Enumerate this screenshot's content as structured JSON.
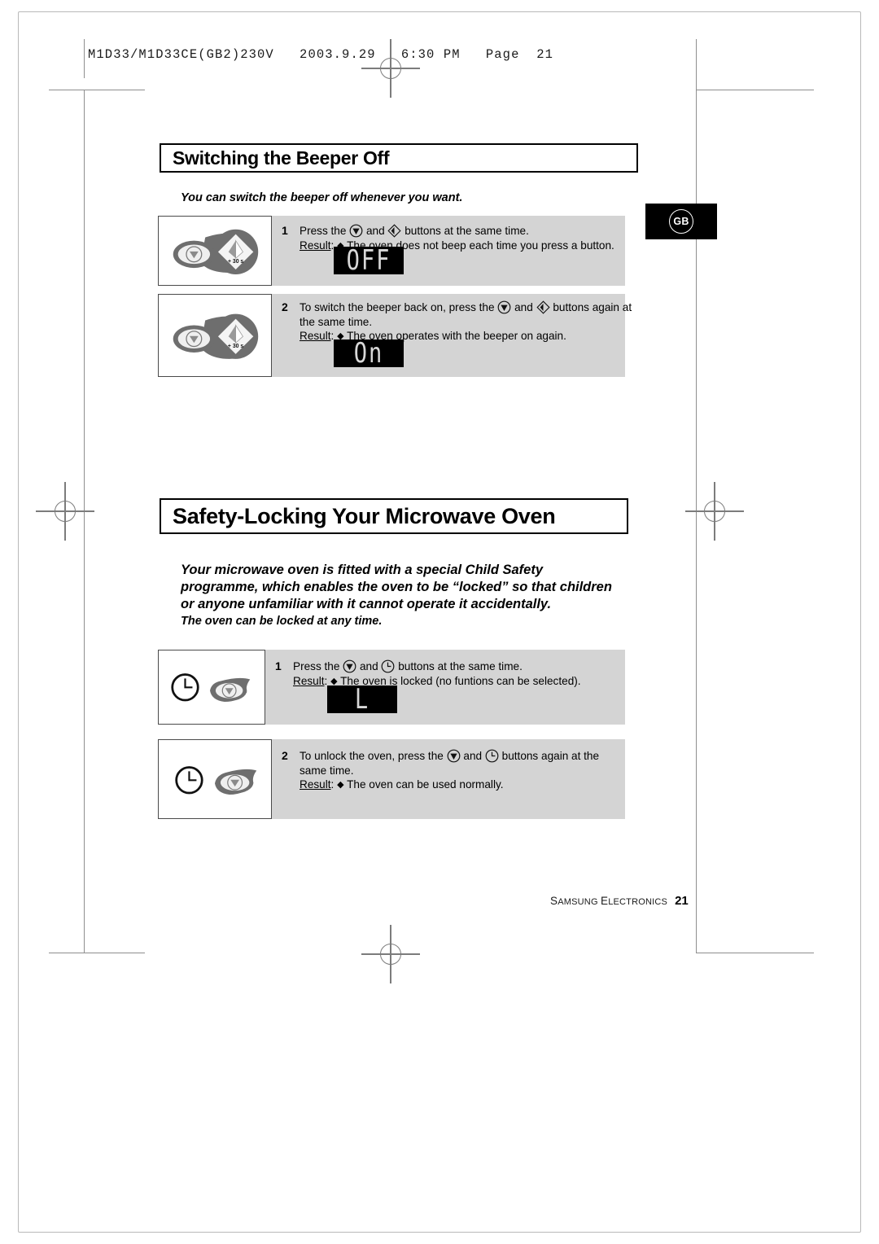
{
  "print_header": "M1D33/M1D33CE(GB2)230V   2003.9.29   6:30 PM   Page  21",
  "region_badge": {
    "code": "GB",
    "name": "gb-region-badge"
  },
  "sections": [
    {
      "id": "beeper",
      "title": "Switching the Beeper Off",
      "intro": "You can switch the beeper off whenever you want.",
      "steps": [
        {
          "number": "1",
          "text_before": "Press the",
          "icon_1": "stop-triangle-icon",
          "text_mid": "and",
          "icon_2": "start-diamond-icon",
          "text_after": "buttons at the same time.",
          "result_label": "Result",
          "result_text": "The oven does not beep each time you press a button.",
          "display": "OFF"
        },
        {
          "number": "2",
          "text_before": "To switch the beeper back on, press the",
          "icon_1": "stop-triangle-icon",
          "text_mid": "and",
          "icon_2": "start-diamond-icon",
          "text_after": "buttons again at the same time.",
          "result_label": "Result",
          "result_text": "The oven operates with the beeper on again.",
          "display": "On"
        }
      ]
    },
    {
      "id": "safety-lock",
      "title": "Safety-Locking Your Microwave Oven",
      "paragraph": "Your microwave oven is fitted with a special Child Safety programme, which enables the oven to be “locked” so that children or anyone unfamiliar with it cannot operate it accidentally.",
      "intro": "The oven can be locked at any time.",
      "steps": [
        {
          "number": "1",
          "text_before": "Press the",
          "icon_1": "stop-triangle-icon",
          "text_mid": "and",
          "icon_2": "clock-icon",
          "text_after": "buttons at the same time.",
          "result_label": "Result",
          "result_text": "The oven is locked (no funtions can be selected).",
          "display": "L"
        },
        {
          "number": "2",
          "text_before": "To unlock the oven, press the",
          "icon_1": "stop-triangle-icon",
          "text_mid": "and",
          "icon_2": "clock-icon",
          "text_after": "buttons again at the same time.",
          "result_label": "Result",
          "result_text": "The oven can be used normally.",
          "display": null
        }
      ]
    }
  ],
  "illustrations": {
    "plus30_label": "+ 30 s"
  },
  "footer": {
    "brand_s": "S",
    "brand_amsung": "AMSUNG",
    "brand_e": "E",
    "brand_lectronics": "LECTRONICS",
    "page_number": "21"
  },
  "colors": {
    "panel_gray": "#d4d4d4",
    "button_gray": "#6e6e6e",
    "lcd_black": "#000000",
    "lcd_text": "#d8d8d8",
    "ink": "#000000"
  }
}
